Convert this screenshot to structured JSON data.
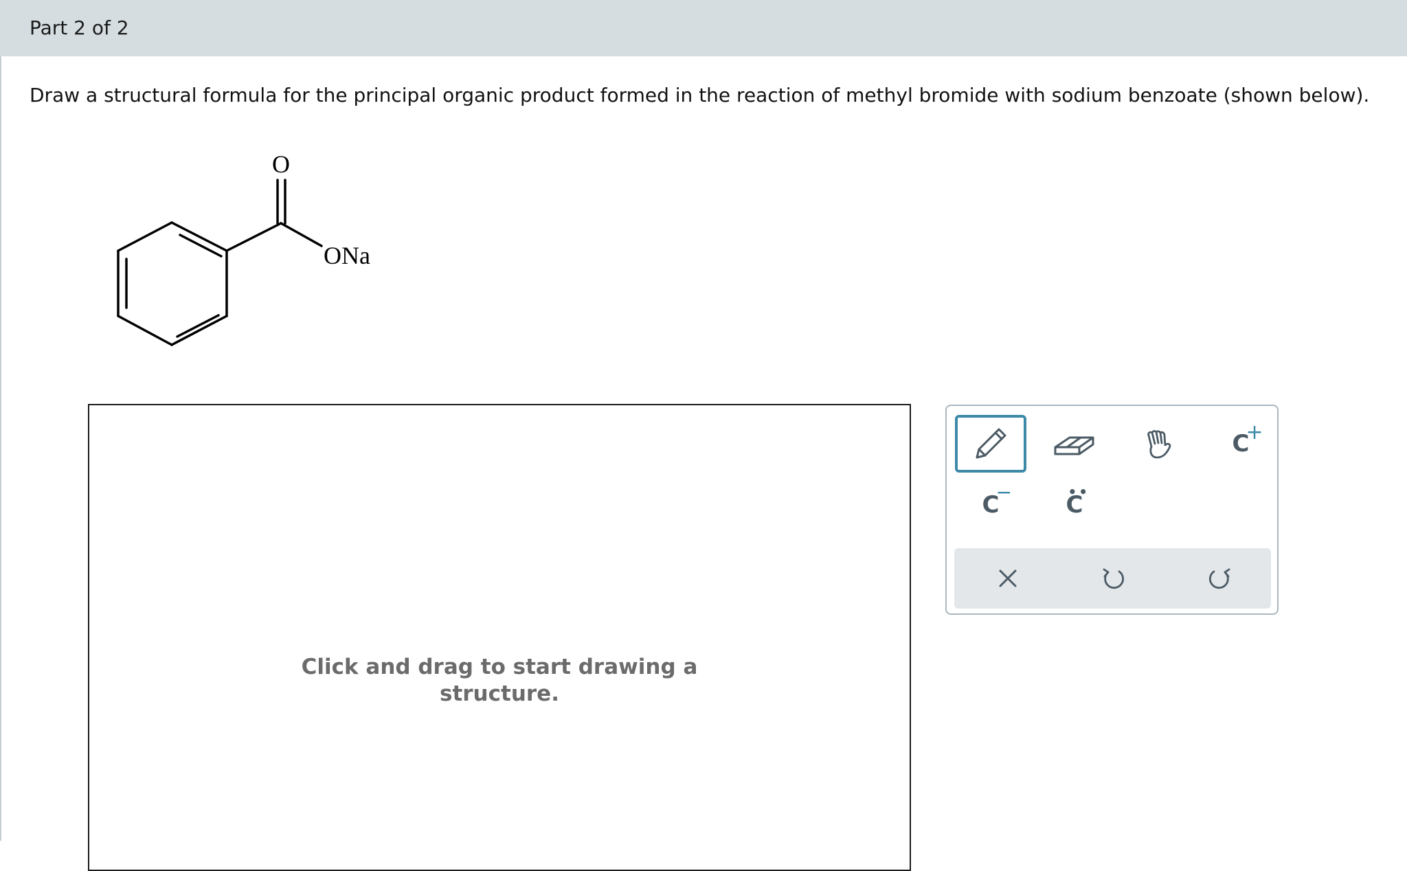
{
  "header": {
    "part_label": "Part 2 of 2"
  },
  "question": {
    "text": "Draw a structural formula for the principal organic product formed in the reaction of methyl bromide with sodium benzoate (shown below)."
  },
  "reactant": {
    "carbonyl_oxygen_label": "O",
    "salt_label": "ONa"
  },
  "canvas": {
    "hint_line1": "Click and drag to start drawing a",
    "hint_line2": "structure."
  },
  "toolbar": {
    "tools": [
      {
        "icon": "pencil-icon",
        "selected": true
      },
      {
        "icon": "eraser-icon",
        "selected": false
      },
      {
        "icon": "hand-icon",
        "selected": false
      },
      {
        "icon": "positive-charge-icon",
        "label": "C",
        "charge": "+"
      },
      {
        "icon": "negative-charge-icon",
        "label": "C",
        "charge": "−"
      },
      {
        "icon": "lone-pair-icon",
        "label": "C"
      }
    ],
    "actions": [
      {
        "icon": "clear-icon"
      },
      {
        "icon": "undo-icon"
      },
      {
        "icon": "redo-icon"
      }
    ]
  }
}
